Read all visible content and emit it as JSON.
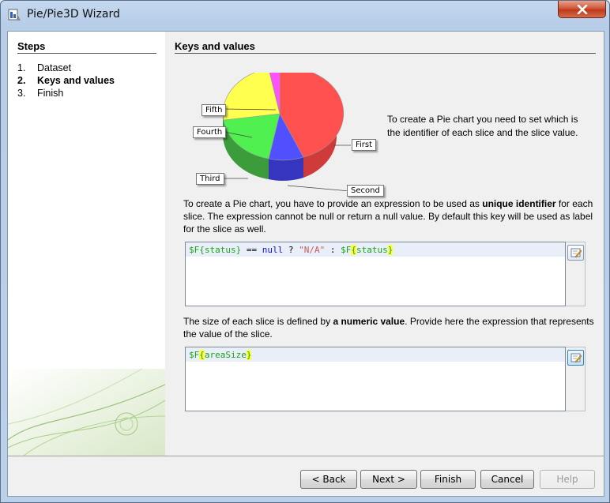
{
  "window": {
    "title": "Pie/Pie3D Wizard"
  },
  "steps": {
    "title": "Steps",
    "items": [
      {
        "num": "1.",
        "label": "Dataset",
        "active": false
      },
      {
        "num": "2.",
        "label": "Keys and values",
        "active": true
      },
      {
        "num": "3.",
        "label": "Finish",
        "active": false
      }
    ]
  },
  "main": {
    "title": "Keys and values",
    "pie_labels": {
      "fifth": "Fifth",
      "fourth": "Fourth",
      "first": "First",
      "third": "Third",
      "second": "Second"
    },
    "pie_colors": {
      "first": "#ff5050",
      "second": "#5050ff",
      "third": "#50f050",
      "fourth": "#ffff50",
      "fifth": "#ff50ff"
    },
    "pie_description": "To create a Pie chart you need to set which is the identifier of each slice and the slice value.",
    "key_para": {
      "part1": "To create a Pie chart, you have to provide an expression to be used as ",
      "bold": "unique identifier",
      "part2": " for each slice. The expression cannot be null or return a null value. By default this key will be used as label for the slice as well."
    },
    "key_expression": {
      "t1": "$F{status}",
      "t2": " == ",
      "t3": "null",
      "t4": " ? ",
      "t5": "\"N/A\"",
      "t6": " : ",
      "t7": "$F",
      "t8": "{",
      "t9": "status",
      "t10": "}"
    },
    "value_para": {
      "part1": "The size of each slice is defined by ",
      "bold": "a numeric value",
      "part2": ". Provide here the expression that represents the value of the slice."
    },
    "value_expression": {
      "t1": "$F",
      "t2": "{",
      "t3": "areaSize",
      "t4": "}"
    }
  },
  "buttons": {
    "back": "< Back",
    "next": "Next >",
    "finish": "Finish",
    "cancel": "Cancel",
    "help": "Help"
  }
}
